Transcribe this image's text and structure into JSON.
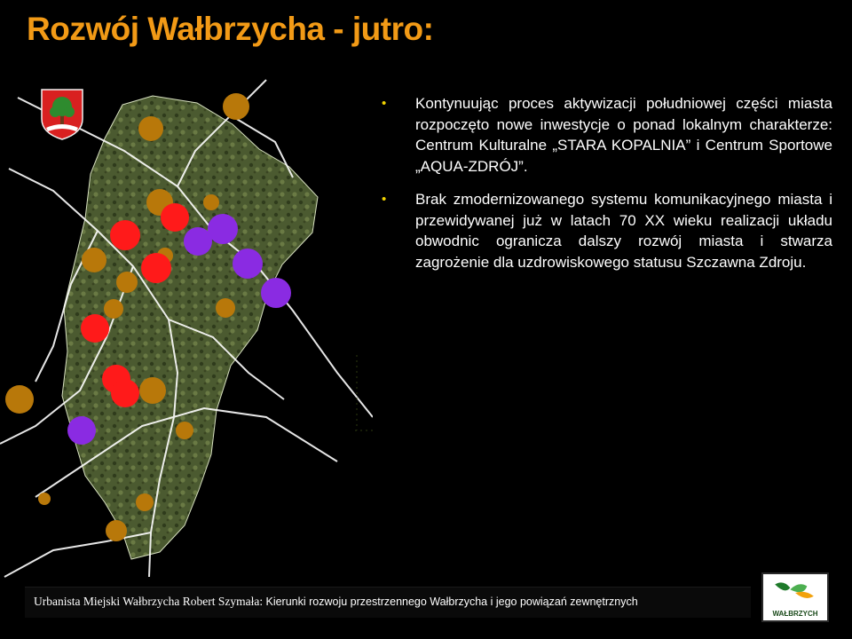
{
  "slide": {
    "title": "Rozwój Wałbrzycha - jutro:"
  },
  "bullets": [
    {
      "segments": [
        "Kontynuując proces aktywizacji południowej części miasta rozpoczęto nowe inwestycje o ponad lokalnym charakterze: Centrum Kulturalne „STARA KOPALNIA” i Centrum Sportowe „AQUA-ZDRÓJ”."
      ]
    },
    {
      "segments": [
        "Brak zmodernizowanego systemu komunikacyjnego miasta i przewidywanej już w latach 70 XX wieku realizacji układu obwodnic ogranicza dalszy rozwój miasta i stwarza zagrożenie dla uzdrowiskowego statusu Szczawna Zdroju."
      ]
    }
  ],
  "footer": {
    "author": "Urbanista Miejski Wałbrzycha Robert Szymała: ",
    "subject": "Kierunki rozwoju przestrzennego Wałbrzycha i jego powiązań zewnętrznych"
  },
  "logo": {
    "caption": "WAŁBRZYCH"
  },
  "map": {
    "colors": {
      "brown": "#b8780a",
      "red": "#ff1a1a",
      "purple": "#8a2be2",
      "road": "#ffffff",
      "terrain": "#4a5a2e"
    }
  }
}
